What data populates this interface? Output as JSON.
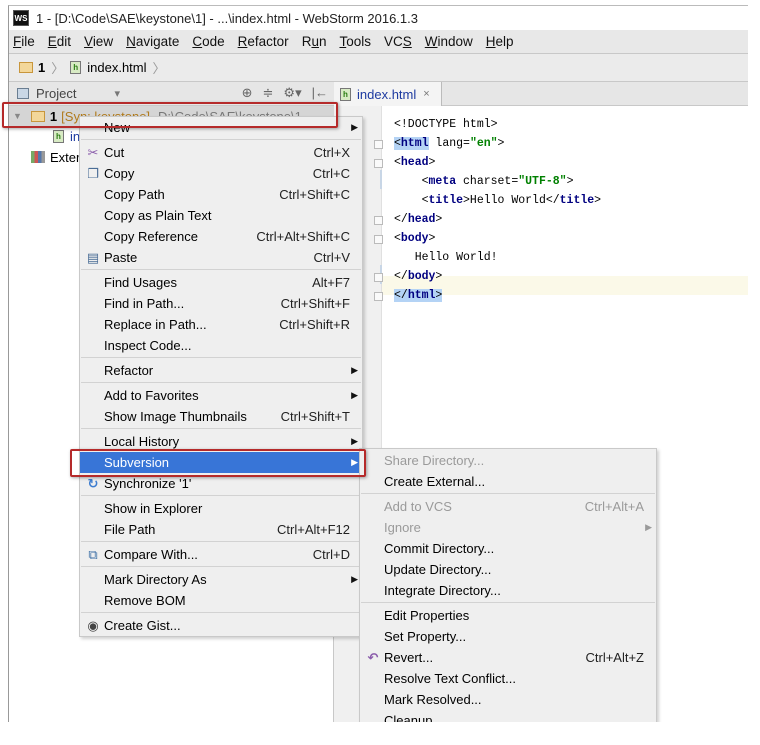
{
  "window": {
    "logo": "WS",
    "title": "1 - [D:\\Code\\SAE\\keystone\\1] - ...\\index.html - WebStorm 2016.1.3"
  },
  "menubar": [
    {
      "pre": "",
      "u": "F",
      "post": "ile"
    },
    {
      "pre": "",
      "u": "E",
      "post": "dit"
    },
    {
      "pre": "",
      "u": "V",
      "post": "iew"
    },
    {
      "pre": "",
      "u": "N",
      "post": "avigate"
    },
    {
      "pre": "",
      "u": "C",
      "post": "ode"
    },
    {
      "pre": "",
      "u": "R",
      "post": "efactor"
    },
    {
      "pre": "R",
      "u": "u",
      "post": "n"
    },
    {
      "pre": "",
      "u": "T",
      "post": "ools"
    },
    {
      "pre": "VC",
      "u": "S",
      "post": ""
    },
    {
      "pre": "",
      "u": "W",
      "post": "indow"
    },
    {
      "pre": "",
      "u": "H",
      "post": "elp"
    }
  ],
  "breadcrumb": {
    "project": "1",
    "file": "index.html"
  },
  "project_panel": {
    "title": "Project",
    "dropdown": "▾",
    "tools": [
      "⊕",
      "≑",
      "⚙▾",
      "|←"
    ],
    "tree": {
      "root_name": "1",
      "root_module": "[Syn: keystone]",
      "root_path": "D:\\Code\\SAE\\keystone\\1",
      "child_file": "index.html",
      "external": "External Libraries"
    }
  },
  "editor": {
    "tab": "index.html",
    "tab_close": "×",
    "lines": [
      "<!DOCTYPE html>",
      "<html lang=\"en\">",
      "<head>",
      "    <meta charset=\"UTF-8\">",
      "    <title>Hello World</title>",
      "</head>",
      "<body>",
      "   Hello World!",
      "</body>",
      "</html>"
    ]
  },
  "context_menu": {
    "items": [
      {
        "label": "New",
        "submenu": true
      },
      {
        "label": "Cut",
        "shortcut": "Ctrl+X",
        "icon": "scissors"
      },
      {
        "label": "Copy",
        "shortcut": "Ctrl+C",
        "icon": "copy"
      },
      {
        "label": "Copy Path",
        "shortcut": "Ctrl+Shift+C"
      },
      {
        "label": "Copy as Plain Text"
      },
      {
        "label": "Copy Reference",
        "shortcut": "Ctrl+Alt+Shift+C"
      },
      {
        "label": "Paste",
        "shortcut": "Ctrl+V",
        "icon": "paste"
      },
      {
        "label": "Find Usages",
        "shortcut": "Alt+F7"
      },
      {
        "label": "Find in Path...",
        "shortcut": "Ctrl+Shift+F"
      },
      {
        "label": "Replace in Path...",
        "shortcut": "Ctrl+Shift+R"
      },
      {
        "label": "Inspect Code..."
      },
      {
        "label": "Refactor",
        "submenu": true
      },
      {
        "label": "Add to Favorites",
        "submenu": true
      },
      {
        "label": "Show Image Thumbnails",
        "shortcut": "Ctrl+Shift+T"
      },
      {
        "label": "Local History",
        "submenu": true
      },
      {
        "label": "Subversion",
        "submenu": true,
        "active": true
      },
      {
        "label": "Synchronize '1'",
        "icon": "sync"
      },
      {
        "label": "Show in Explorer"
      },
      {
        "label": "File Path",
        "shortcut": "Ctrl+Alt+F12"
      },
      {
        "label": "Compare With...",
        "shortcut": "Ctrl+D",
        "icon": "compare"
      },
      {
        "label": "Mark Directory As",
        "submenu": true
      },
      {
        "label": "Remove BOM"
      },
      {
        "label": "Create Gist...",
        "icon": "github"
      }
    ]
  },
  "subversion_menu": {
    "items": [
      {
        "label": "Share Directory...",
        "disabled": true
      },
      {
        "label": "Create External..."
      },
      {
        "label": "Add to VCS",
        "shortcut": "Ctrl+Alt+A",
        "disabled": true
      },
      {
        "label": "Ignore",
        "submenu": true,
        "disabled": true
      },
      {
        "label": "Commit Directory..."
      },
      {
        "label": "Update Directory..."
      },
      {
        "label": "Integrate Directory..."
      },
      {
        "label": "Edit Properties"
      },
      {
        "label": "Set Property..."
      },
      {
        "label": "Revert...",
        "shortcut": "Ctrl+Alt+Z",
        "icon": "revert"
      },
      {
        "label": "Resolve Text Conflict..."
      },
      {
        "label": "Mark Resolved..."
      },
      {
        "label": "Cleanup"
      }
    ]
  },
  "colors": {
    "selection": "#3875d7",
    "highlight_box": "#b52a2a",
    "tag": "#000080",
    "attr_value": "#008000"
  }
}
